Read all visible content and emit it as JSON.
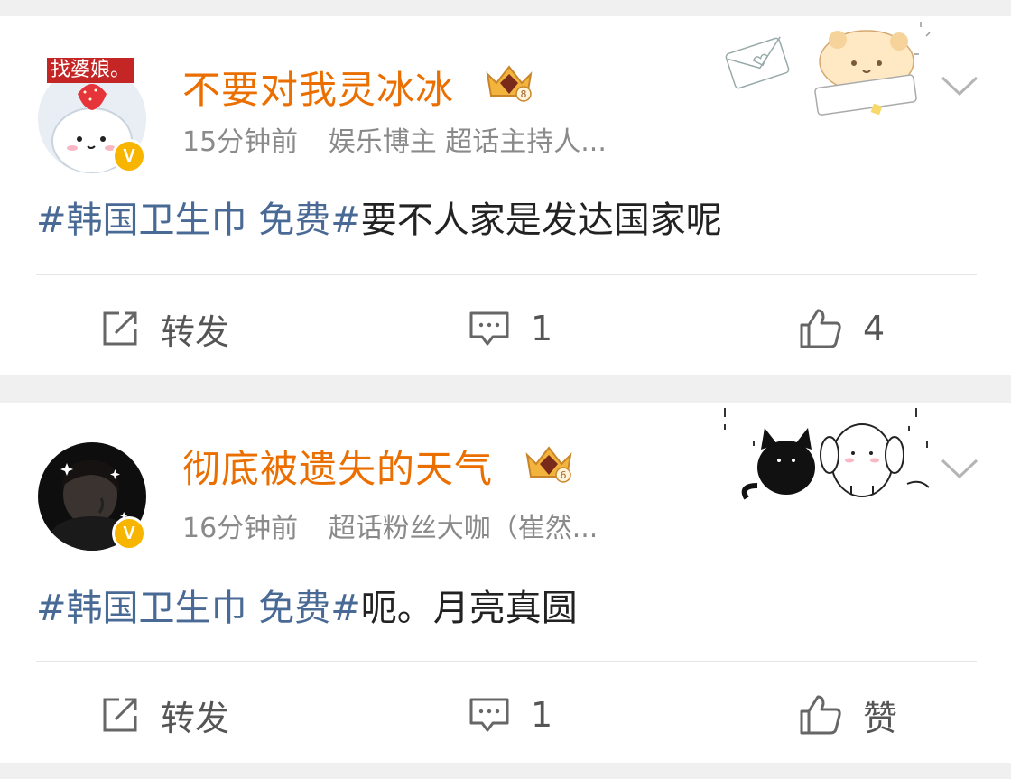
{
  "posts": [
    {
      "avatar_tag": "找婆娘。",
      "username": "不要对我灵冰冰",
      "crown_level": "8",
      "time": "15分钟前",
      "badge_text": "娱乐博主 超话主持人...",
      "topic": "#韩国卫生巾 免费#",
      "text": "要不人家是发达国家呢",
      "repost_label": "转发",
      "comment_count": "1",
      "like_label": "4"
    },
    {
      "username": "彻底被遗失的天气",
      "crown_level": "6",
      "time": "16分钟前",
      "badge_text": "超话粉丝大咖（崔然...",
      "topic": "#韩国卫生巾 免费#",
      "text": "呃。月亮真圆",
      "repost_label": "转发",
      "comment_count": "1",
      "like_label": "赞"
    }
  ],
  "icons": {
    "verified": "verified-badge-icon",
    "crown": "crown-icon",
    "chevron": "chevron-down-icon",
    "repost": "repost-icon",
    "comment": "comment-icon",
    "like": "thumbs-up-icon"
  },
  "colors": {
    "username": "#ea6f00",
    "topic": "#4a6a96",
    "meta": "#8a8a8a",
    "verified": "#f7b500",
    "avatar_tag_bg": "#c42525"
  },
  "verified_mark": "V"
}
